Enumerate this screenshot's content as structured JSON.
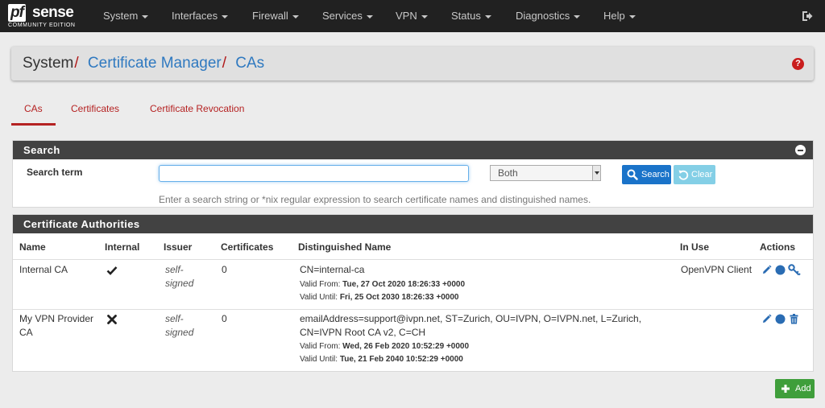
{
  "logo": {
    "brand_left": "pf",
    "brand_right": "sense",
    "edition": "COMMUNITY EDITION"
  },
  "nav": {
    "items": [
      {
        "label": "System"
      },
      {
        "label": "Interfaces"
      },
      {
        "label": "Firewall"
      },
      {
        "label": "Services"
      },
      {
        "label": "VPN"
      },
      {
        "label": "Status"
      },
      {
        "label": "Diagnostics"
      },
      {
        "label": "Help"
      }
    ],
    "logout_icon": "logout-icon"
  },
  "breadcrumb": {
    "root": "System",
    "sep1": "/",
    "link1": "Certificate Manager",
    "sep2": "/",
    "link2": "CAs",
    "help_icon": "question-icon",
    "help_glyph": "?"
  },
  "tabs": [
    {
      "label": "CAs",
      "active": true
    },
    {
      "label": "Certificates",
      "active": false
    },
    {
      "label": "Certificate Revocation",
      "active": false
    }
  ],
  "search": {
    "title": "Search",
    "term_label": "Search term",
    "value": "",
    "scope_selected": "Both",
    "search_label": "Search",
    "clear_label": "Clear",
    "help_text": "Enter a search string or *nix regular expression to search certificate names and distinguished names."
  },
  "table": {
    "title": "Certificate Authorities",
    "columns": {
      "name": "Name",
      "internal": "Internal",
      "issuer": "Issuer",
      "certificates": "Certificates",
      "dn": "Distinguished Name",
      "in_use": "In Use",
      "actions": "Actions"
    },
    "rows": [
      {
        "name": "Internal CA",
        "internal_icon": "check-icon",
        "issuer": "self-signed",
        "certificates": "0",
        "dn": "CN=internal-ca",
        "valid_from_label": "Valid From:",
        "valid_from": "Tue, 27 Oct 2020 18:26:33 +0000",
        "valid_until_label": "Valid Until:",
        "valid_until": "Fri, 25 Oct 2030 18:26:33 +0000",
        "in_use": "OpenVPN Client",
        "actions": [
          "pencil-icon",
          "certificate-icon",
          "key-icon"
        ]
      },
      {
        "name": "My VPN Provider CA",
        "internal_icon": "times-icon",
        "issuer": "self-signed",
        "certificates": "0",
        "dn": "emailAddress=support@ivpn.net, ST=Zurich, OU=IVPN, O=IVPN.net, L=Zurich, CN=IVPN Root CA v2, C=CH",
        "valid_from_label": "Valid From:",
        "valid_from": "Wed, 26 Feb 2020 10:52:29 +0000",
        "valid_until_label": "Valid Until:",
        "valid_until": "Tue, 21 Feb 2040 10:52:29 +0000",
        "in_use": "",
        "actions": [
          "pencil-icon",
          "certificate-icon",
          "trash-icon"
        ]
      }
    ]
  },
  "add_label": "Add",
  "colors": {
    "navbar": "#212121",
    "accent_red": "#b52222",
    "link_blue": "#2f79c0",
    "search_blue": "#1a73c9",
    "add_green": "#3f9e3b"
  }
}
